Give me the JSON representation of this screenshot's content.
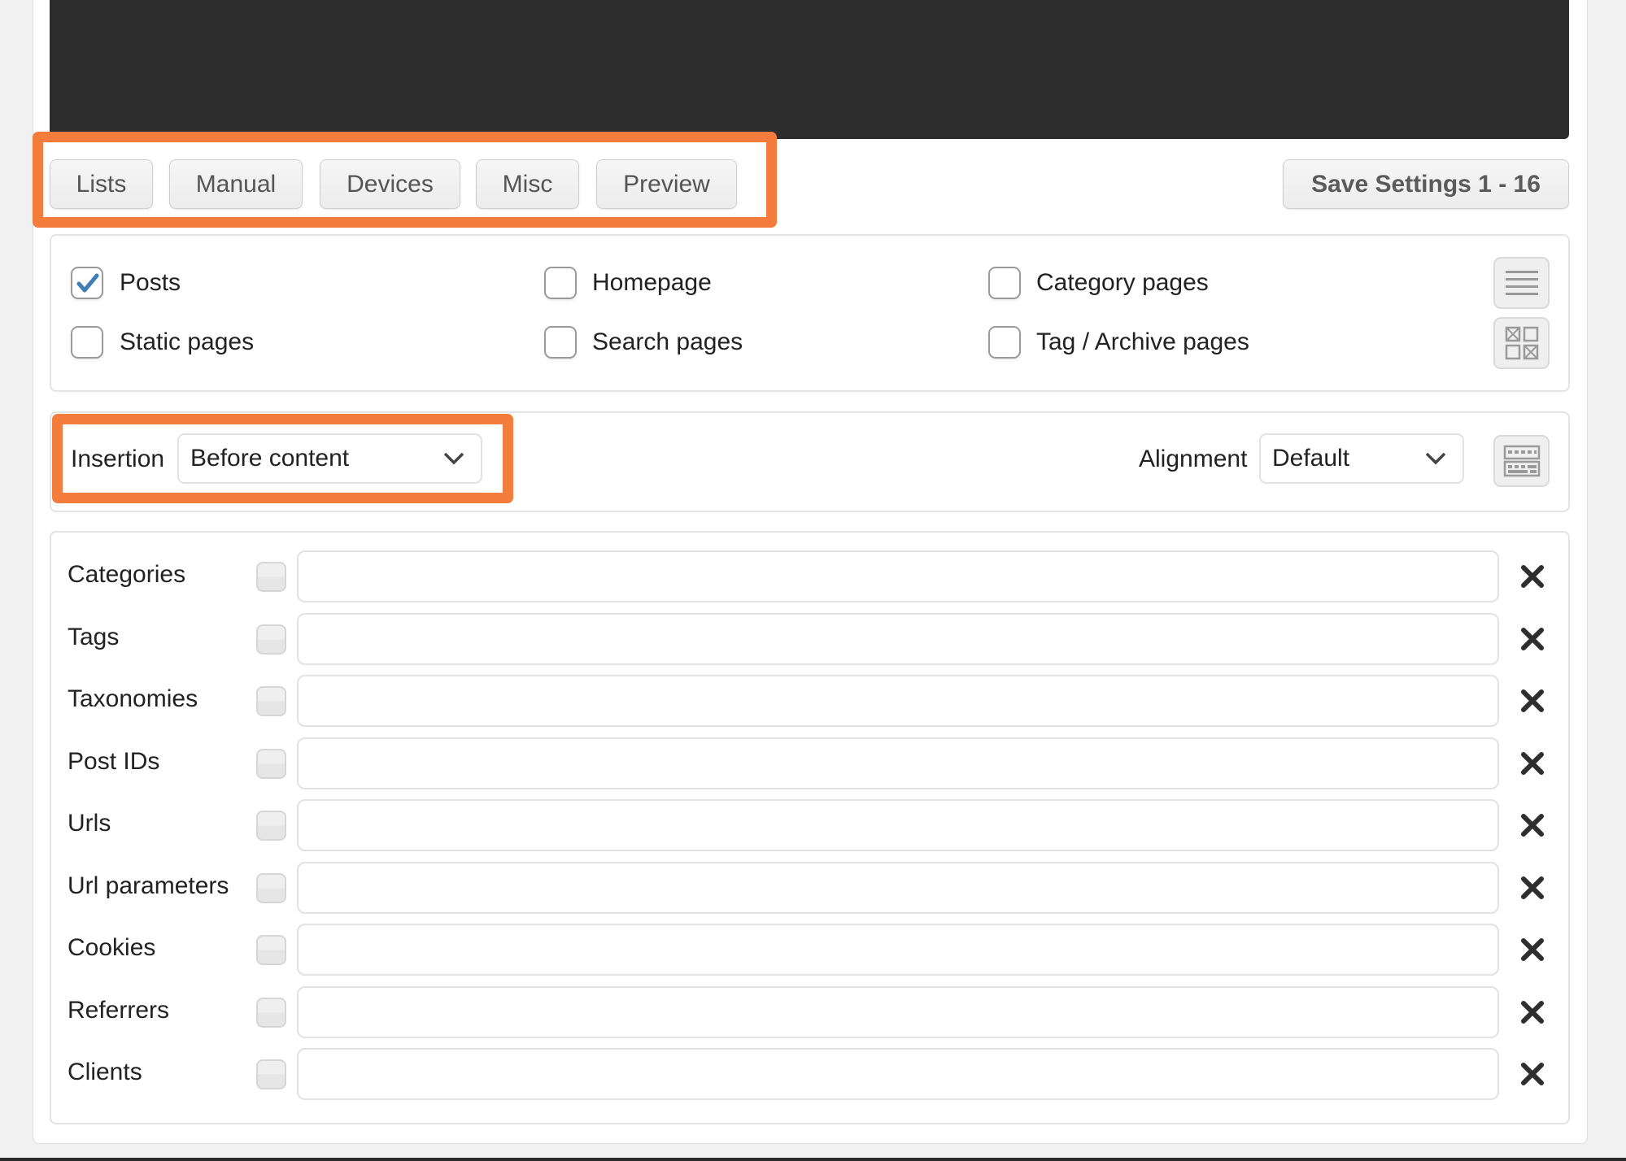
{
  "tabs": [
    {
      "label": "Lists"
    },
    {
      "label": "Manual"
    },
    {
      "label": "Devices"
    },
    {
      "label": "Misc"
    },
    {
      "label": "Preview"
    }
  ],
  "save_button": {
    "label": "Save Settings 1 - 16"
  },
  "page_types": [
    {
      "label": "Posts",
      "checked": true
    },
    {
      "label": "Homepage",
      "checked": false
    },
    {
      "label": "Category pages",
      "checked": false
    },
    {
      "label": "Static pages",
      "checked": false
    },
    {
      "label": "Search pages",
      "checked": false
    },
    {
      "label": "Tag / Archive pages",
      "checked": false
    }
  ],
  "side_icons": [
    "list-icon",
    "grid-toggle-icon"
  ],
  "insertion": {
    "label": "Insertion",
    "value": "Before content"
  },
  "alignment": {
    "label": "Alignment",
    "value": "Default"
  },
  "alignment_icon": "keyboard-icon",
  "filters": [
    {
      "label": "Categories",
      "value": ""
    },
    {
      "label": "Tags",
      "value": ""
    },
    {
      "label": "Taxonomies",
      "value": ""
    },
    {
      "label": "Post IDs",
      "value": ""
    },
    {
      "label": "Urls",
      "value": ""
    },
    {
      "label": "Url parameters",
      "value": ""
    },
    {
      "label": "Cookies",
      "value": ""
    },
    {
      "label": "Referrers",
      "value": ""
    },
    {
      "label": "Clients",
      "value": ""
    }
  ],
  "colors": {
    "highlight": "#f47c3c",
    "checkmark": "#3f7fb5",
    "header_dark": "#2d2d2d"
  }
}
